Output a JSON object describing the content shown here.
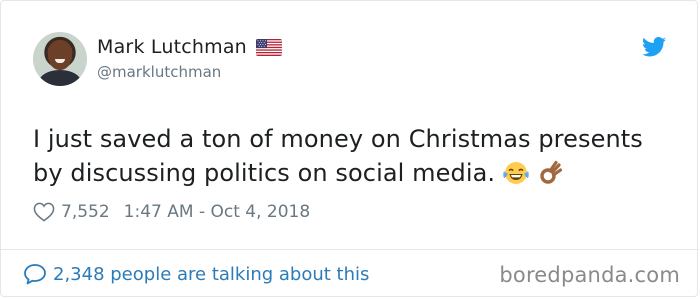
{
  "tweet": {
    "author_name": "Mark Lutchman",
    "author_handle": "@marklutchman",
    "flag_icon": "us-flag-icon",
    "platform_icon": "twitter-bird-icon",
    "text_line1": "I just saved a ton of money on Christmas presents",
    "text_line2": "by discussing politics on social media.",
    "emojis": [
      "tears-of-joy-emoji",
      "ok-hand-emoji"
    ],
    "like_count": "7,552",
    "timestamp": "1:47 AM - Oct 4, 2018",
    "conversation_link": "2,348 people are talking about this"
  },
  "watermark": "boredpanda.com",
  "colors": {
    "text": "#1c2022",
    "muted": "#697882",
    "link": "#2b7bb9",
    "twitter_blue": "#1da1f2",
    "border": "#e1e8ed"
  }
}
